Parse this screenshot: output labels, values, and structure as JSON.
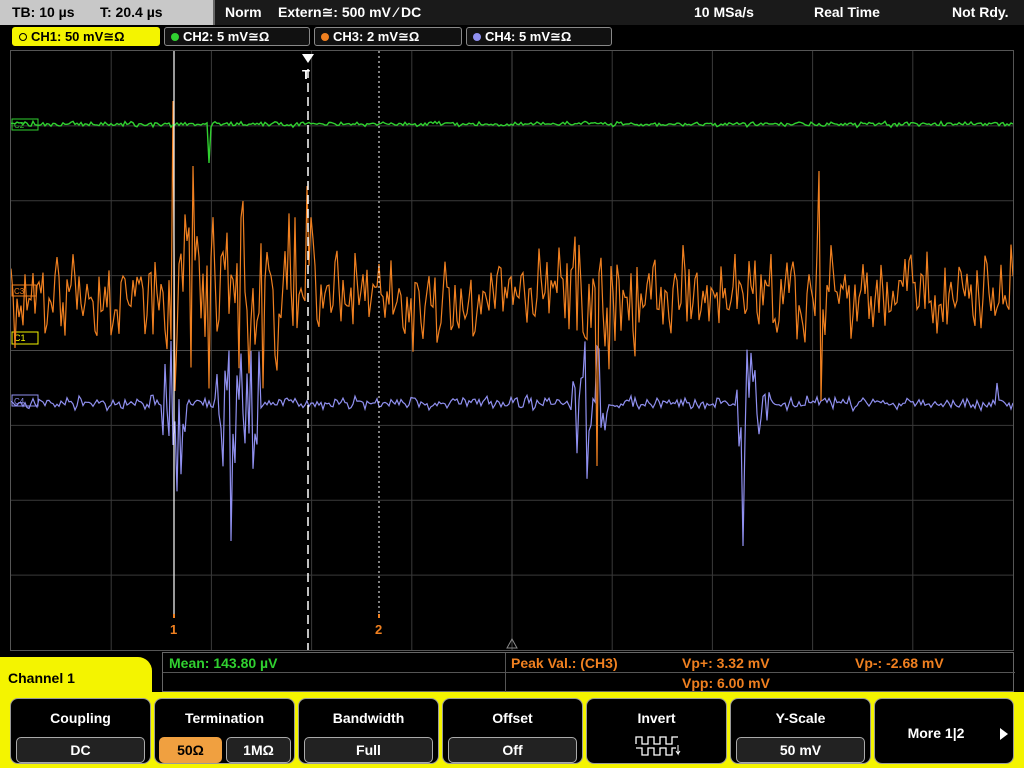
{
  "top_bar": {
    "timebase": "TB: 10 µs",
    "trigger_time": "T: 20.4 µs",
    "trigger_mode": "Norm",
    "trigger_source": "Extern≅: 500 mV ⁄ DC",
    "sample_rate": "10 MSa/s",
    "acquisition_mode": "Real Time",
    "status": "Not Rdy."
  },
  "channels": [
    {
      "label": "CH1: 50 mV≅Ω",
      "color": "#f4f400",
      "active": true
    },
    {
      "label": "CH2: 5 mV≅Ω",
      "color": "#30d030"
    },
    {
      "label": "CH3: 2 mV≅Ω",
      "color": "#f08020"
    },
    {
      "label": "CH4: 5 mV≅Ω",
      "color": "#9090f0"
    }
  ],
  "screen": {
    "cursor1_label": "1",
    "cursor2_label": "2",
    "trigger_marker": "T",
    "ch_markers": [
      "C2",
      "C3",
      "C1",
      "C4"
    ]
  },
  "measurements": {
    "mean": "Mean: 143.80 µV",
    "peak_label": "Peak Val.:  (CH3)",
    "vp_plus": "Vp+: 3.32 mV",
    "vp_minus": "Vp-: -2.68 mV",
    "vpp": "Vpp: 6.00 mV"
  },
  "menu": {
    "title": "Channel 1",
    "coupling": {
      "title": "Coupling",
      "value": "DC"
    },
    "termination": {
      "title": "Termination",
      "option_a": "50Ω",
      "option_b": "1MΩ"
    },
    "bandwidth": {
      "title": "Bandwidth",
      "value": "Full"
    },
    "offset": {
      "title": "Offset",
      "value": "Off"
    },
    "invert": {
      "title": "Invert"
    },
    "yscale": {
      "title": "Y-Scale",
      "value": "50 mV"
    },
    "more": {
      "label": "More 1|2"
    }
  },
  "colors": {
    "ch1": "#f4f400",
    "ch2": "#30d030",
    "ch3": "#f08020",
    "ch4": "#9090f0",
    "grid": "#3a3a3a"
  }
}
